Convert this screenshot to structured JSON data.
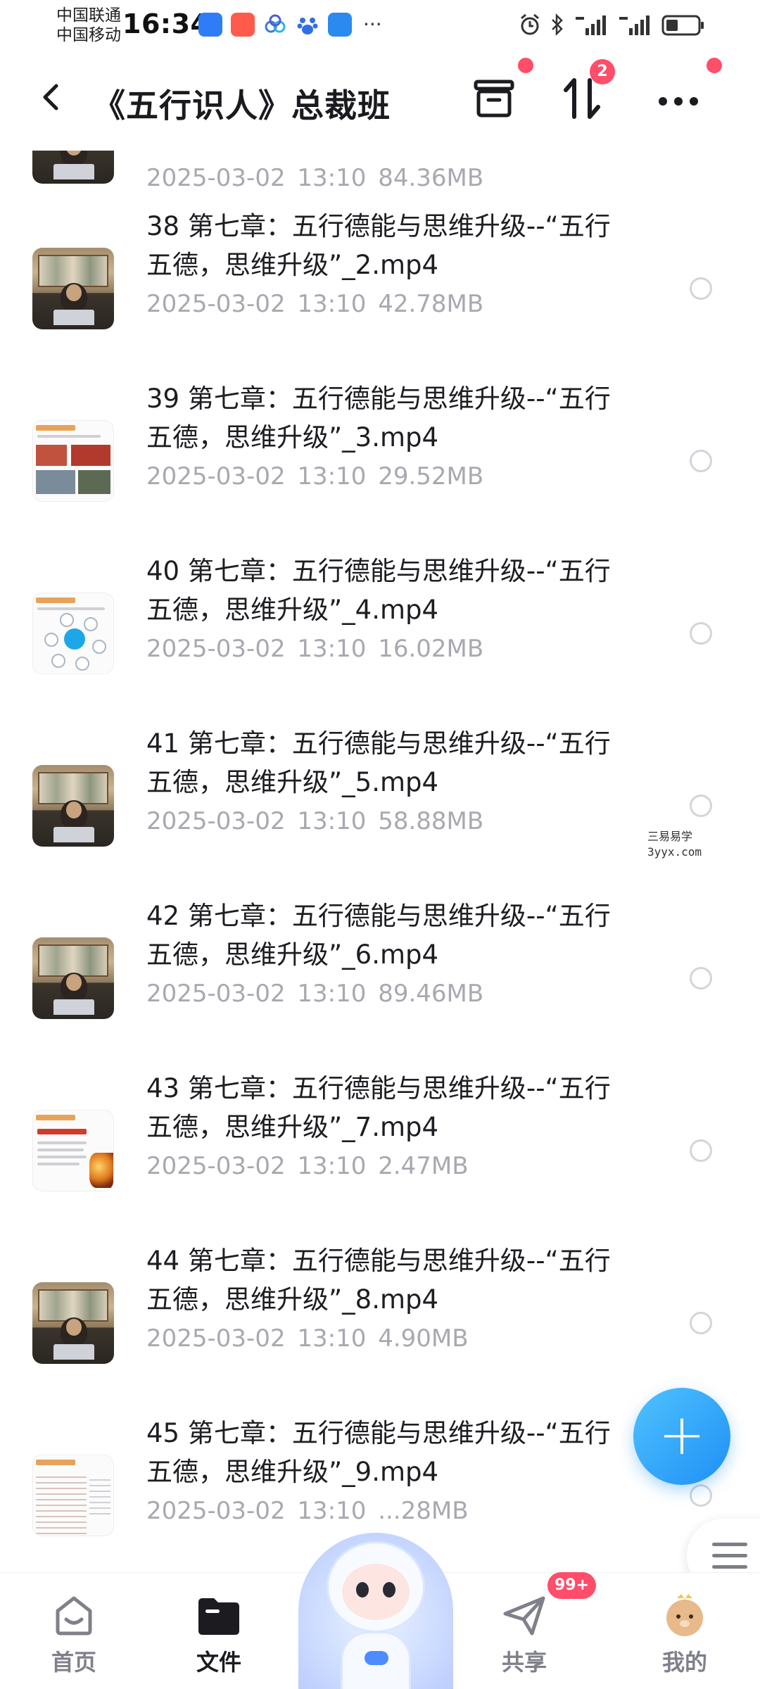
{
  "status_bar": {
    "carrier_1": "中国联通",
    "carrier_2": "中国移动",
    "time": "16:34",
    "more": "···"
  },
  "header": {
    "title": "《五行识人》总裁班",
    "sort_badge": "2"
  },
  "files": [
    {
      "name": "",
      "date": "2025-03-02",
      "time": "13:10",
      "size": "84.36MB",
      "thumb": "video"
    },
    {
      "name": "38 第七章：五行德能与思维升级--“五行五德，思维升级”_2.mp4",
      "date": "2025-03-02",
      "time": "13:10",
      "size": "42.78MB",
      "thumb": "video"
    },
    {
      "name": "39 第七章：五行德能与思维升级--“五行五德，思维升级”_3.mp4",
      "date": "2025-03-02",
      "time": "13:10",
      "size": "29.52MB",
      "thumb": "slide-photos"
    },
    {
      "name": "40 第七章：五行德能与思维升级--“五行五德，思维升级”_4.mp4",
      "date": "2025-03-02",
      "time": "13:10",
      "size": "16.02MB",
      "thumb": "slide-diagram"
    },
    {
      "name": "41 第七章：五行德能与思维升级--“五行五德，思维升级”_5.mp4",
      "date": "2025-03-02",
      "time": "13:10",
      "size": "58.88MB",
      "thumb": "video"
    },
    {
      "name": "42 第七章：五行德能与思维升级--“五行五德，思维升级”_6.mp4",
      "date": "2025-03-02",
      "time": "13:10",
      "size": "89.46MB",
      "thumb": "video"
    },
    {
      "name": "43 第七章：五行德能与思维升级--“五行五德，思维升级”_7.mp4",
      "date": "2025-03-02",
      "time": "13:10",
      "size": "2.47MB",
      "thumb": "slide-sun"
    },
    {
      "name": "44 第七章：五行德能与思维升级--“五行五德，思维升级”_8.mp4",
      "date": "2025-03-02",
      "time": "13:10",
      "size": "4.90MB",
      "thumb": "video"
    },
    {
      "name": "45 第七章：五行德能与思维升级--“五行五德，思维升级”_9.mp4",
      "date": "2025-03-02",
      "time": "13:10",
      "size": "...28MB",
      "thumb": "slide-table"
    }
  ],
  "watermark": {
    "line1": "三易易学",
    "line2": "3yyx.com"
  },
  "fab": {
    "icon": "plus-icon",
    "label": "+"
  },
  "tabs": [
    {
      "label": "首页",
      "icon": "home-icon",
      "active": false
    },
    {
      "label": "文件",
      "icon": "folder-icon",
      "active": true
    },
    {
      "label": "共享",
      "icon": "send-icon",
      "active": false
    },
    {
      "label": "我的",
      "icon": "avatar-icon",
      "active": false
    }
  ],
  "share_badge": "99+",
  "colors": {
    "accent": "#1f8ff5",
    "badge": "#ff4d6a",
    "meta_text": "#a8a9b0"
  }
}
